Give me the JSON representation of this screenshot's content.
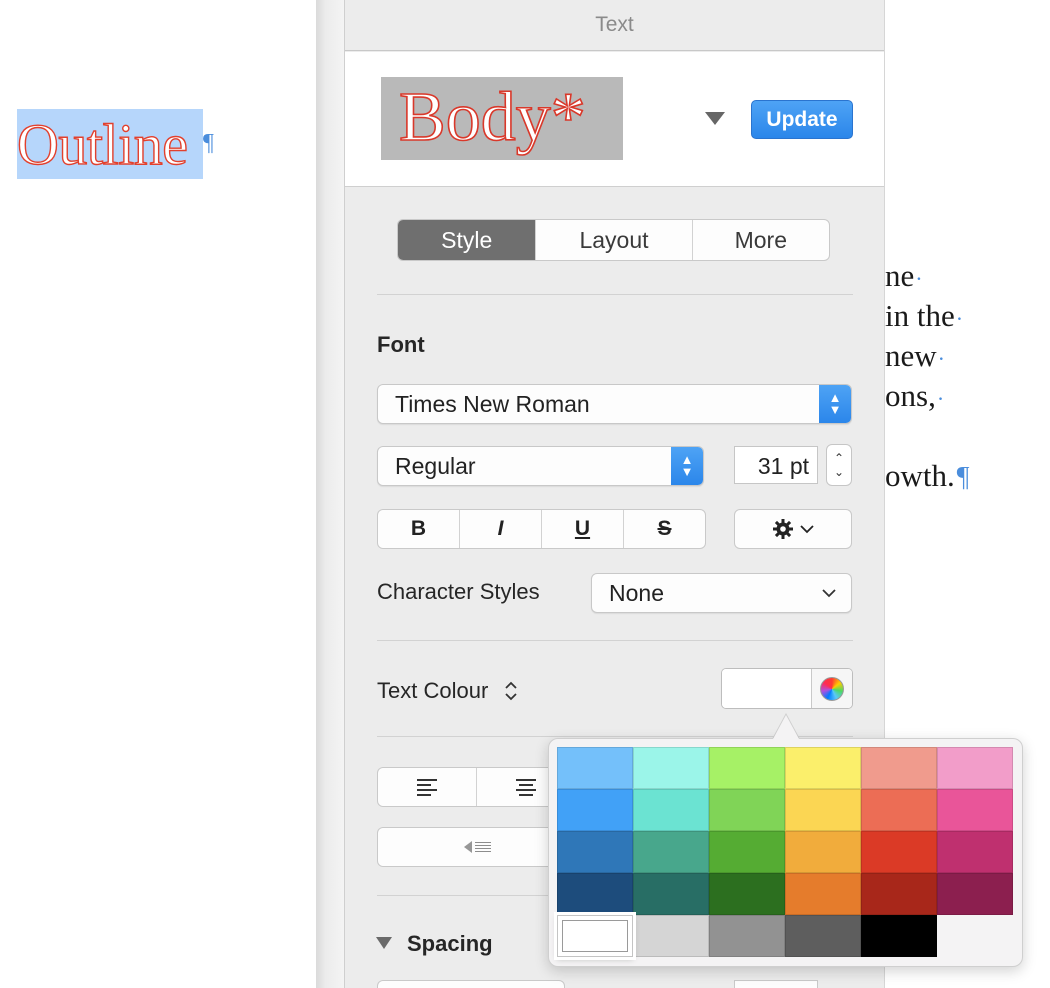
{
  "document": {
    "selected_word": "Outline",
    "pilcrow": "¶",
    "body_fragments": [
      "ne",
      "in the",
      "new",
      "ons,",
      "owth."
    ],
    "fragment_marks": [
      "·",
      "·",
      "·",
      "·",
      "¶"
    ],
    "selection_color": "#b6d6fb",
    "outline_color": "#e2402d"
  },
  "inspector": {
    "title": "Text",
    "paragraph_style": {
      "name": "Body*",
      "update_label": "Update",
      "menu_icon": "triangle-down-icon"
    },
    "tabs": [
      {
        "label": "Style",
        "active": true
      },
      {
        "label": "Layout",
        "active": false
      },
      {
        "label": "More",
        "active": false
      }
    ],
    "font": {
      "section_label": "Font",
      "family": "Times New Roman",
      "typeface": "Regular",
      "size": "31 pt"
    },
    "format_buttons": [
      "B",
      "I",
      "U",
      "S"
    ],
    "gear_icon": "gear-icon",
    "character_styles": {
      "label": "Character Styles",
      "value": "None"
    },
    "text_colour": {
      "label": "Text Colour",
      "current": "#ffffff"
    },
    "spacing": {
      "label": "Spacing"
    },
    "accent_color": "#3192ef"
  },
  "colour_palette": {
    "rows": [
      [
        "#74c0fa",
        "#9bf5e9",
        "#a6f166",
        "#fbef6b",
        "#f09b8d",
        "#f29dc9"
      ],
      [
        "#41a1f7",
        "#6be3d2",
        "#80d457",
        "#fbd653",
        "#ec6d55",
        "#e95599"
      ],
      [
        "#2f77b8",
        "#48a78c",
        "#55ac33",
        "#f1ac3c",
        "#db3a26",
        "#bf306f"
      ],
      [
        "#1d4c7c",
        "#286e65",
        "#2c6f1f",
        "#e57c2c",
        "#a8271a",
        "#8c1f4f"
      ],
      [
        "#ffffff",
        "#d5d5d5",
        "#929292",
        "#5e5e5e",
        "#000000",
        ""
      ]
    ],
    "selected": "#ffffff"
  }
}
